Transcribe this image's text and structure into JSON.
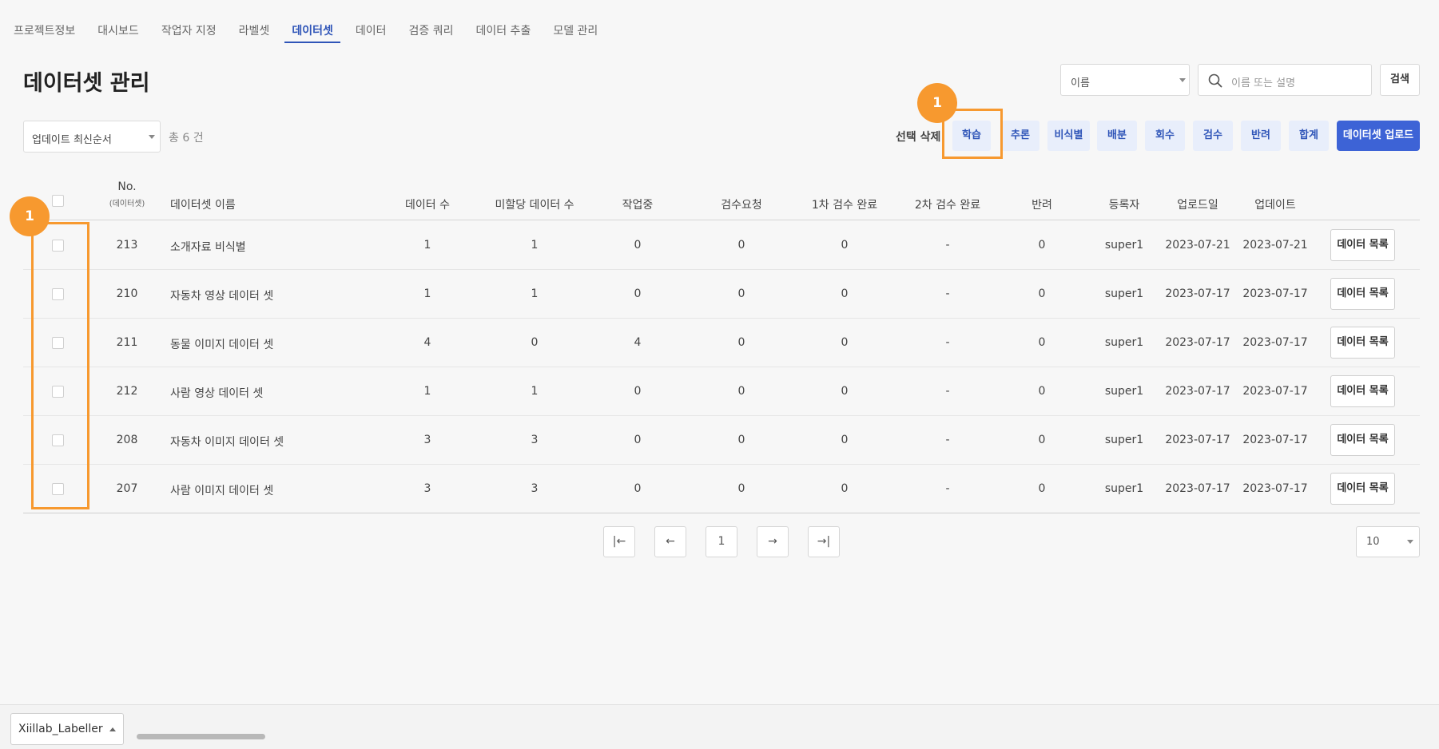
{
  "nav": {
    "tabs": [
      {
        "label": "프로젝트정보"
      },
      {
        "label": "대시보드"
      },
      {
        "label": "작업자 지정"
      },
      {
        "label": "라벨셋"
      },
      {
        "label": "데이터셋"
      },
      {
        "label": "데이터"
      },
      {
        "label": "검증 쿼리"
      },
      {
        "label": "데이터 추출"
      },
      {
        "label": "모델 관리"
      }
    ],
    "active": "데이터셋"
  },
  "page_title": "데이터셋 관리",
  "search": {
    "field_select": "이름",
    "placeholder": "이름 또는 설명",
    "button": "검색"
  },
  "toolbar": {
    "sort": "업데이트 최신순서",
    "total": "총 6 건",
    "select_delete": "선택 삭제",
    "actions": [
      "학습",
      "추론",
      "비식별",
      "배분",
      "회수",
      "검수",
      "반려",
      "합계"
    ],
    "upload": "데이터셋 업로드"
  },
  "table": {
    "headers": {
      "no": "No.",
      "no_sub": "(데이터셋)",
      "name": "데이터셋 이름",
      "data_count": "데이터 수",
      "unassigned": "미할당 데이터 수",
      "working": "작업중",
      "review_request": "검수요청",
      "review1_done": "1차 검수 완료",
      "review2_done": "2차 검수 완료",
      "rejected": "반려",
      "registrant": "등록자",
      "uploaded": "업로드일",
      "updated": "업데이트"
    },
    "row_button": "데이터 목록",
    "rows": [
      {
        "no": "213",
        "name": "소개자료 비식별",
        "data_count": "1",
        "unassigned": "1",
        "working": "0",
        "review_request": "0",
        "review1_done": "0",
        "review2_done": "-",
        "rejected": "0",
        "registrant": "super1",
        "uploaded": "2023-07-21",
        "updated": "2023-07-21"
      },
      {
        "no": "210",
        "name": "자동차 영상 데이터 셋",
        "data_count": "1",
        "unassigned": "1",
        "working": "0",
        "review_request": "0",
        "review1_done": "0",
        "review2_done": "-",
        "rejected": "0",
        "registrant": "super1",
        "uploaded": "2023-07-17",
        "updated": "2023-07-17"
      },
      {
        "no": "211",
        "name": "동물 이미지 데이터 셋",
        "data_count": "4",
        "unassigned": "0",
        "working": "4",
        "review_request": "0",
        "review1_done": "0",
        "review2_done": "-",
        "rejected": "0",
        "registrant": "super1",
        "uploaded": "2023-07-17",
        "updated": "2023-07-17"
      },
      {
        "no": "212",
        "name": "사람 영상 데이터 셋",
        "data_count": "1",
        "unassigned": "1",
        "working": "0",
        "review_request": "0",
        "review1_done": "0",
        "review2_done": "-",
        "rejected": "0",
        "registrant": "super1",
        "uploaded": "2023-07-17",
        "updated": "2023-07-17"
      },
      {
        "no": "208",
        "name": "자동차 이미지 데이터 셋",
        "data_count": "3",
        "unassigned": "3",
        "working": "0",
        "review_request": "0",
        "review1_done": "0",
        "review2_done": "-",
        "rejected": "0",
        "registrant": "super1",
        "uploaded": "2023-07-17",
        "updated": "2023-07-17"
      },
      {
        "no": "207",
        "name": "사람 이미지 데이터 셋",
        "data_count": "3",
        "unassigned": "3",
        "working": "0",
        "review_request": "0",
        "review1_done": "0",
        "review2_done": "-",
        "rejected": "0",
        "registrant": "super1",
        "uploaded": "2023-07-17",
        "updated": "2023-07-17"
      }
    ]
  },
  "pagination": {
    "first": "|←",
    "prev": "←",
    "current": "1",
    "next": "→",
    "last": "→|",
    "page_size": "10"
  },
  "annotations": {
    "badge_top": "1",
    "badge_left": "1",
    "color": "#f7992f"
  },
  "footer": {
    "workspace": "Xiillab_Labeller"
  },
  "colors": {
    "accent": "#2f55b8",
    "primary_button": "#3d63d6",
    "action_bg": "#e8eefb"
  }
}
